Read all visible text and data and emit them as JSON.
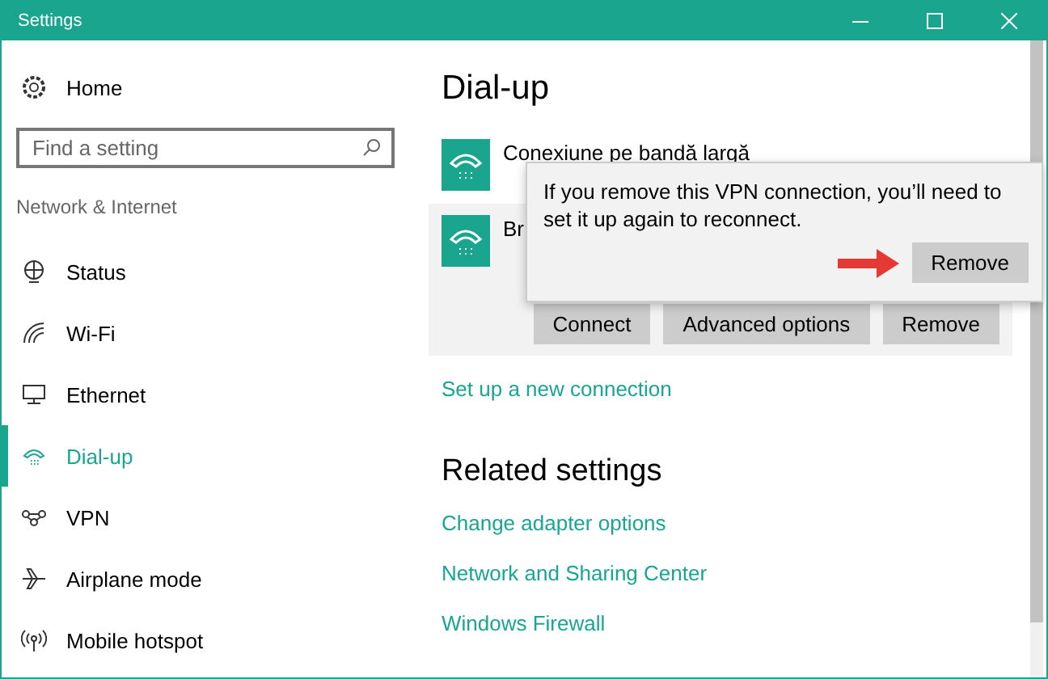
{
  "window": {
    "title": "Settings"
  },
  "sidebar": {
    "home": "Home",
    "search": {
      "placeholder": "Find a setting"
    },
    "section": "Network & Internet",
    "items": [
      {
        "label": "Status",
        "kind": "status",
        "selected": false
      },
      {
        "label": "Wi-Fi",
        "kind": "wifi",
        "selected": false
      },
      {
        "label": "Ethernet",
        "kind": "ethernet",
        "selected": false
      },
      {
        "label": "Dial-up",
        "kind": "dialup",
        "selected": true
      },
      {
        "label": "VPN",
        "kind": "vpn",
        "selected": false
      },
      {
        "label": "Airplane mode",
        "kind": "airplane",
        "selected": false
      },
      {
        "label": "Mobile hotspot",
        "kind": "hotspot",
        "selected": false
      }
    ]
  },
  "main": {
    "title": "Dial-up",
    "connections": [
      {
        "name": "Conexiune pe bandă largă",
        "expanded": false
      },
      {
        "name": "Br",
        "expanded": true,
        "buttons": [
          "Connect",
          "Advanced options",
          "Remove"
        ]
      }
    ],
    "setup_link": "Set up a new connection",
    "related_title": "Related settings",
    "related_links": [
      "Change adapter options",
      "Network and Sharing Center",
      "Windows Firewall"
    ]
  },
  "flyout": {
    "message": "If you remove this VPN connection, you’ll need to set it up again to reconnect.",
    "button": "Remove"
  }
}
